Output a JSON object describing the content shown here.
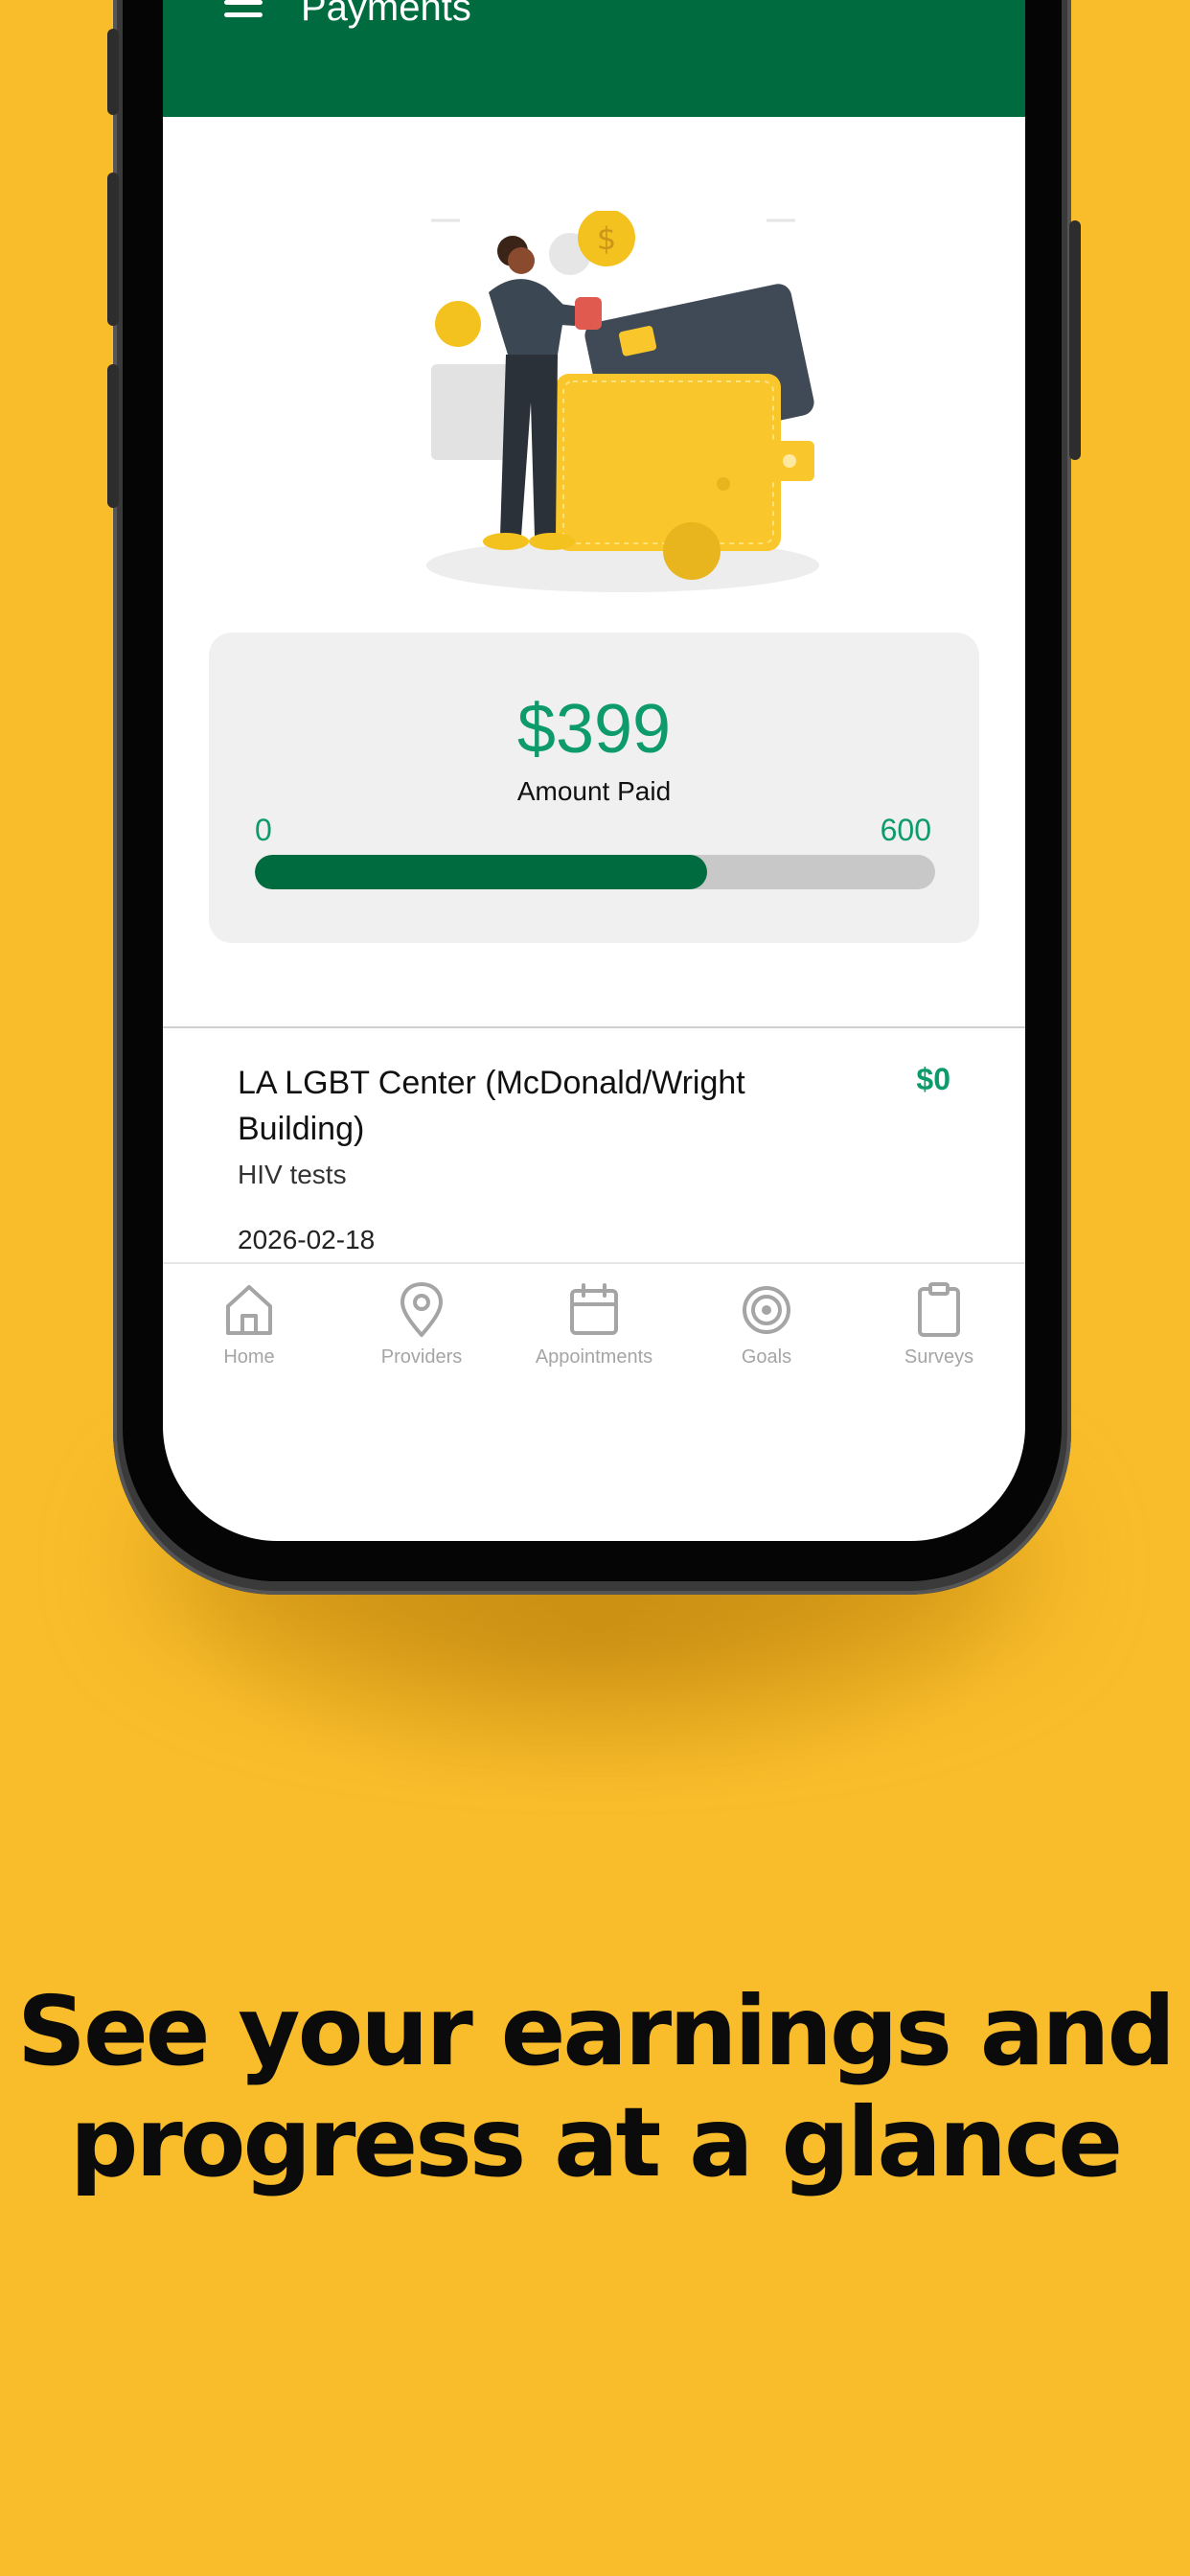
{
  "app": {
    "title": "Payments"
  },
  "summary": {
    "amount": "$399",
    "label": "Amount Paid",
    "range_min": "0",
    "range_max": "600",
    "progress_fraction": 0.665
  },
  "payments": [
    {
      "provider": "LA LGBT Center (McDonald/Wright Building)",
      "amount": "$0",
      "description": "HIV tests",
      "date": "2026-02-18"
    }
  ],
  "nav": {
    "items": [
      {
        "label": "Home",
        "icon": "home-icon"
      },
      {
        "label": "Providers",
        "icon": "map-pin-icon"
      },
      {
        "label": "Appointments",
        "icon": "calendar-icon"
      },
      {
        "label": "Goals",
        "icon": "target-icon"
      },
      {
        "label": "Surveys",
        "icon": "clipboard-icon"
      }
    ]
  },
  "marketing": {
    "headline_line1": "See your earnings and",
    "headline_line2": "progress at a glance"
  },
  "colors": {
    "background": "#F9BD2B",
    "header": "#006B3F",
    "accent": "#0E9B6B",
    "progress_track": "#C8C8C8"
  }
}
